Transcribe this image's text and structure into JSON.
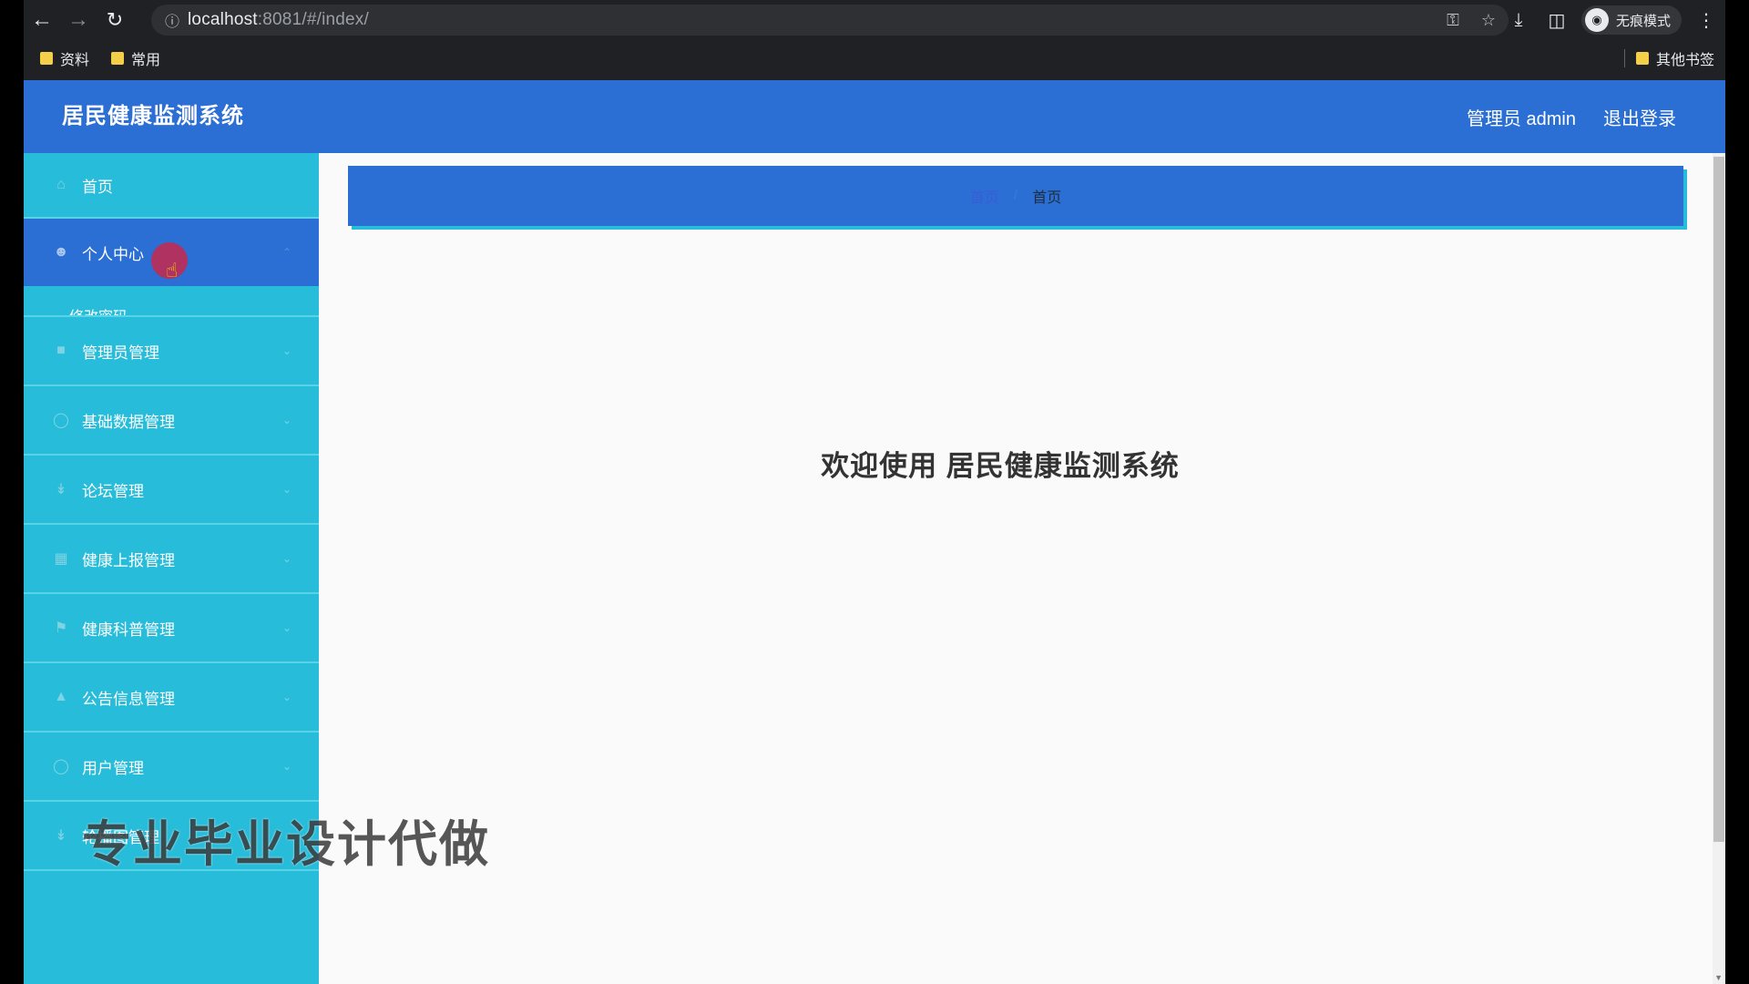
{
  "browser": {
    "url_host": "localhost",
    "url_rest": ":8081/#/index/",
    "incognito_label": "无痕模式",
    "bookmarks": [
      "资料",
      "常用"
    ],
    "other_bookmarks": "其他书签"
  },
  "header": {
    "title": "居民健康监测系统",
    "user_label": "管理员 admin",
    "logout_label": "退出登录"
  },
  "sidebar": {
    "items": [
      {
        "label": "首页",
        "icon": "home-icon"
      },
      {
        "label": "个人中心",
        "icon": "user-icon",
        "expanded": true
      },
      {
        "label": "管理员管理",
        "icon": "admin-icon"
      },
      {
        "label": "基础数据管理",
        "icon": "data-icon"
      },
      {
        "label": "论坛管理",
        "icon": "forum-icon"
      },
      {
        "label": "健康上报管理",
        "icon": "report-icon"
      },
      {
        "label": "健康科普管理",
        "icon": "flag-icon"
      },
      {
        "label": "公告信息管理",
        "icon": "notice-icon"
      },
      {
        "label": "用户管理",
        "icon": "users-icon"
      },
      {
        "label": "轮播图管理",
        "icon": "carousel-icon"
      }
    ],
    "submenu_item": "修改密码"
  },
  "breadcrumb": {
    "home": "首页",
    "current": "首页"
  },
  "main": {
    "welcome": "欢迎使用 居民健康监测系统"
  },
  "overlay": {
    "watermark": "专业毕业设计代做"
  },
  "colors": {
    "header_blue": "#2b6ed4",
    "sidebar_cyan": "#27bcd9"
  }
}
